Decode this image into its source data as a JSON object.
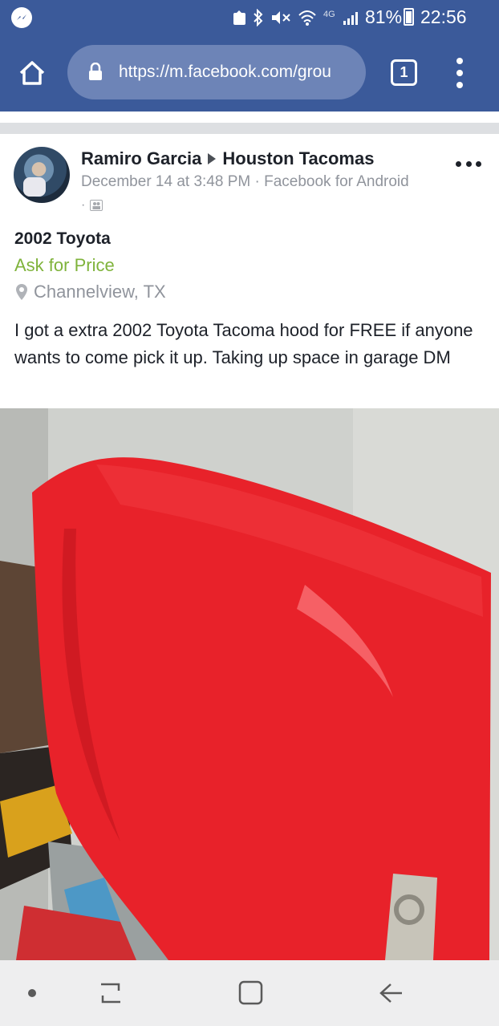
{
  "status_bar": {
    "network": "4G",
    "battery": "81%",
    "time": "22:56",
    "icons": [
      "messenger-icon",
      "cast-icon",
      "bluetooth-icon",
      "mute-icon",
      "wifi-icon",
      "signal-icon",
      "battery-icon"
    ]
  },
  "browser": {
    "url": "https://m.facebook.com/grou",
    "tab_count": "1"
  },
  "post": {
    "author": "Ramiro Garcia",
    "group": "Houston Tacomas",
    "meta": "December 14 at 3:48 PM · Facebook for Android",
    "meta_prefix": "·",
    "title": "2002 Toyota",
    "price": "Ask for Price",
    "location": "Channelview, TX",
    "body": "I got a extra 2002 Toyota Tacoma hood for FREE if anyone wants to come pick it up. Taking up space in garage DM"
  },
  "colors": {
    "brand": "#3b5a9a",
    "price": "#7fb33b",
    "hood": "#e8222a"
  }
}
